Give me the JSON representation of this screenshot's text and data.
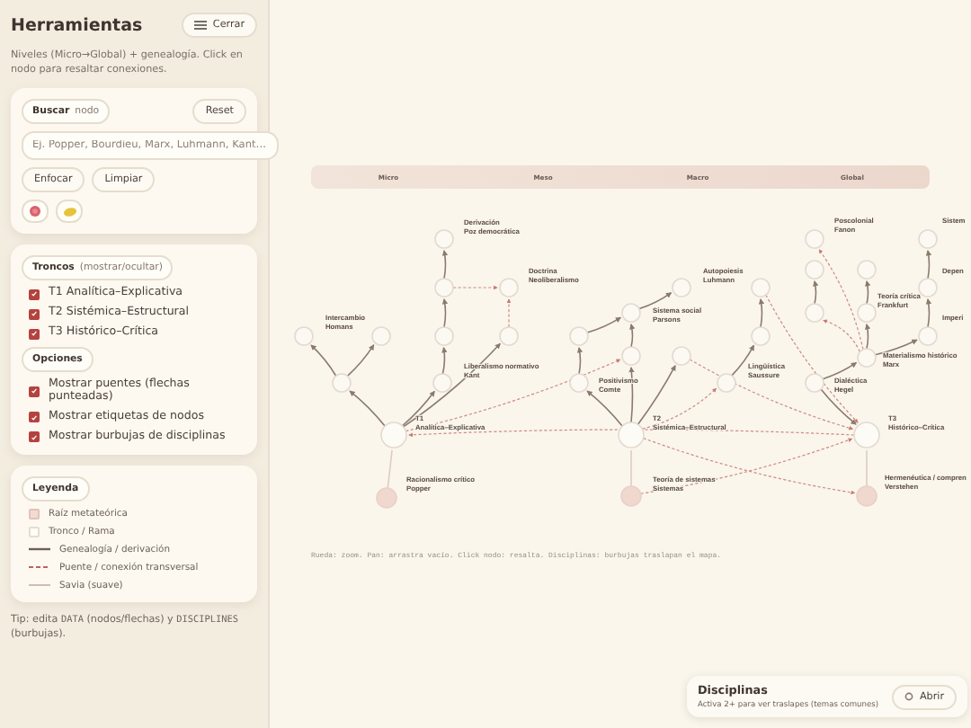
{
  "panel": {
    "title": "Herramientas",
    "close_button": "Cerrar",
    "description": "Niveles (Micro→Global) + genealogía. Click en nodo para resaltar conexiones.",
    "search": {
      "label": "Buscar",
      "hint": "nodo",
      "reset": "Reset",
      "placeholder": "Ej. Popper, Bourdieu, Marx, Luhmann, Kant…",
      "buttons": [
        "Enfocar",
        "Limpiar"
      ]
    },
    "trunks": {
      "label": "Troncos",
      "hint": "(mostrar/ocultar)",
      "items": [
        {
          "label": "T1 Analítica–Explicativa",
          "checked": true
        },
        {
          "label": "T2 Sistémica–Estructural",
          "checked": true
        },
        {
          "label": "T3 Histórico–Crítica",
          "checked": true
        }
      ]
    },
    "options": {
      "label": "Opciones",
      "items": [
        {
          "label": "Mostrar puentes (flechas punteadas)",
          "checked": true
        },
        {
          "label": "Mostrar etiquetas de nodos",
          "checked": true
        },
        {
          "label": "Mostrar burbujas de disciplinas",
          "checked": true
        }
      ]
    },
    "legend": {
      "label": "Leyenda",
      "items": [
        {
          "kind": "root",
          "label": "Raíz metateórica"
        },
        {
          "kind": "trunk",
          "label": "Tronco / Rama"
        },
        {
          "kind": "genealogy",
          "label": "Genealogía / derivación"
        },
        {
          "kind": "bridge",
          "label": "Puente / conexión transversal"
        },
        {
          "kind": "sap",
          "label": "Savia (suave)"
        }
      ]
    },
    "tip": [
      {
        "kind": "text",
        "text": "Tip: edita "
      },
      {
        "kind": "code",
        "text": "DATA"
      },
      {
        "kind": "text",
        "text": " (nodos/flechas) y "
      },
      {
        "kind": "code",
        "text": "DISCIPLINES"
      },
      {
        "kind": "text",
        "text": " (burbujas)."
      }
    ]
  },
  "map": {
    "levels": [
      "Micro",
      "Meso",
      "Macro",
      "Global"
    ],
    "nodes": [
      {
        "kind": "branch",
        "lines": [
          "Derivación",
          "Poz democrática"
        ]
      },
      {
        "kind": "branch",
        "lines": [
          "Poscolonial",
          "Fanon"
        ]
      },
      {
        "kind": "branch",
        "lines": [
          "Sistem"
        ]
      },
      {
        "kind": "branch"
      },
      {
        "kind": "branch"
      },
      {
        "kind": "branch"
      },
      {
        "kind": "branch",
        "lines": [
          "Doctrina",
          "Neoliberalismo"
        ]
      },
      {
        "kind": "branch",
        "lines": [
          "Autopoiesis",
          "Luhmann"
        ]
      },
      {
        "kind": "branch"
      },
      {
        "kind": "branch",
        "lines": [
          "Depen"
        ]
      },
      {
        "kind": "branch",
        "lines": [
          "Sistema social",
          "Parsons"
        ]
      },
      {
        "kind": "branch"
      },
      {
        "kind": "branch",
        "lines": [
          "Teoría crítica",
          "Frankfurt"
        ]
      },
      {
        "kind": "branch",
        "lines": [
          "Intercambio",
          "Homans"
        ]
      },
      {
        "kind": "branch"
      },
      {
        "kind": "branch"
      },
      {
        "kind": "branch"
      },
      {
        "kind": "branch"
      },
      {
        "kind": "branch"
      },
      {
        "kind": "branch",
        "lines": [
          "Imperi"
        ]
      },
      {
        "kind": "branch"
      },
      {
        "kind": "branch"
      },
      {
        "kind": "branch",
        "lines": [
          "Materialismo histórico",
          "Marx"
        ]
      },
      {
        "kind": "branch"
      },
      {
        "kind": "branch",
        "lines": [
          "Liberalismo normativo",
          "Kant"
        ]
      },
      {
        "kind": "branch",
        "lines": [
          "Positivismo",
          "Comte"
        ]
      },
      {
        "kind": "branch",
        "lines": [
          "Lingüística",
          "Saussure"
        ]
      },
      {
        "kind": "branch",
        "lines": [
          "Dialéctica",
          "Hegel"
        ]
      },
      {
        "kind": "trunk",
        "lines": [
          "T1",
          "Analítica–Explicativa"
        ]
      },
      {
        "kind": "trunk",
        "lines": [
          "T2",
          "Sistémica–Estructural"
        ]
      },
      {
        "kind": "trunk",
        "lines": [
          "T3",
          "Histórico–Crítica"
        ]
      },
      {
        "kind": "root",
        "lines": [
          "Racionalismo crítico",
          "Popper"
        ]
      },
      {
        "kind": "root",
        "lines": [
          "Teoría de sistemas",
          "Sistemas"
        ]
      },
      {
        "kind": "root",
        "lines": [
          "Hermenéutica / compren",
          "Verstehen"
        ]
      }
    ],
    "hint": "Rueda: zoom. Pan: arrastra vacío. Click nodo: resalta. Disciplinas: burbujas traslapan el mapa."
  },
  "disciplines": {
    "title": "Disciplinas",
    "subtitle": "Activa 2+ para ver traslapes (temas comunes)",
    "button": "Abrir"
  }
}
